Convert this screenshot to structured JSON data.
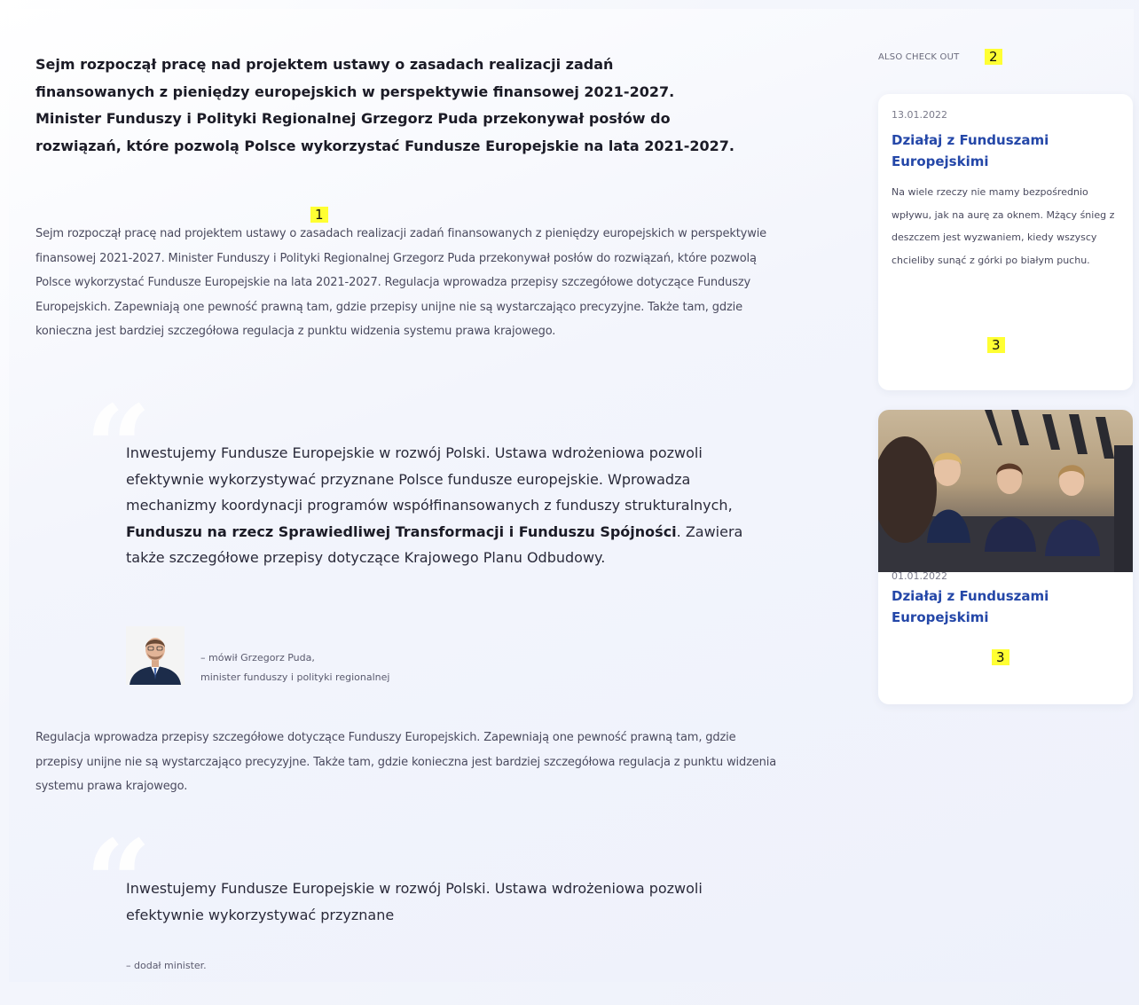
{
  "article": {
    "lead": "Sejm rozpoczął pracę nad projektem ustawy o zasadach realizacji zadań finansowanych z pieniędzy europejskich w perspektywie finansowej 2021-2027. Minister Funduszy i Polityki Regionalnej Grzegorz Puda przekonywał posłów do rozwiązań, które pozwolą Polsce wykorzystać Fundusze Europejskie na lata 2021-2027.",
    "paragraph1": "Sejm rozpoczął pracę nad projektem ustawy o zasadach realizacji zadań finansowanych z pieniędzy europejskich w perspektywie finansowej 2021-2027. Minister Funduszy i Polityki Regionalnej Grzegorz Puda przekonywał posłów do rozwiązań, które pozwolą Polsce wykorzystać Fundusze Europejskie na lata 2021-2027. Regulacja wprowadza przepisy szczegółowe dotyczące Funduszy Europejskich. Zapewniają one pewność prawną tam, gdzie przepisy unijne nie są wystarczająco precyzyjne. Także tam, gdzie konieczna jest bardziej szczegółowa regulacja z punktu widzenia systemu prawa krajowego.",
    "quote1": {
      "text_before": "Inwestujemy Fundusze Europejskie w rozwój Polski. Ustawa wdrożeniowa pozwoli efektywnie wykorzystywać przyznane Polsce fundusze europejskie. Wprowadza mechanizmy koordynacji programów współfinansowanych z funduszy strukturalnych, ",
      "text_bold": "Funduszu na rzecz Sprawiedliwej Transformacji i Funduszu Spójności",
      "text_after": ". Zawiera także szczegółowe przepisy dotyczące Krajowego Planu Odbudowy.",
      "attribution_line1": "– mówił Grzegorz Puda,",
      "attribution_line2": "minister funduszy i polityki regionalnej"
    },
    "paragraph2": "Regulacja wprowadza przepisy szczegółowe dotyczące Funduszy Europejskich. Zapewniają one pewność prawną tam, gdzie przepisy unijne nie są wystarczająco precyzyjne. Także tam, gdzie konieczna jest bardziej szczegółowa regulacja z punktu widzenia systemu prawa krajowego.",
    "quote2": {
      "text": "Inwestujemy Fundusze Europejskie w rozwój Polski. Ustawa wdrożeniowa pozwoli efektywnie wykorzystywać przyznane",
      "attribution": "– dodał minister."
    }
  },
  "sidebar": {
    "label": "ALSO CHECK OUT",
    "cards": [
      {
        "date": "13.01.2022",
        "title": "Działaj z Funduszami Europejskimi",
        "description": "Na wiele rzeczy nie mamy bezpośrednio wpływu, jak na aurę za oknem. Mżący śnieg z deszczem jest wyzwaniem, kiedy wszyscy chcieliby sunąć z górki po białym puchu."
      },
      {
        "date": "01.01.2022",
        "title": "Działaj z Funduszami Europejskimi"
      }
    ]
  },
  "markers": {
    "m1": "1",
    "m2": "2",
    "m3a": "3",
    "m3b": "3"
  },
  "colors": {
    "accent": "#2447a8",
    "highlight": "#ffff33"
  }
}
